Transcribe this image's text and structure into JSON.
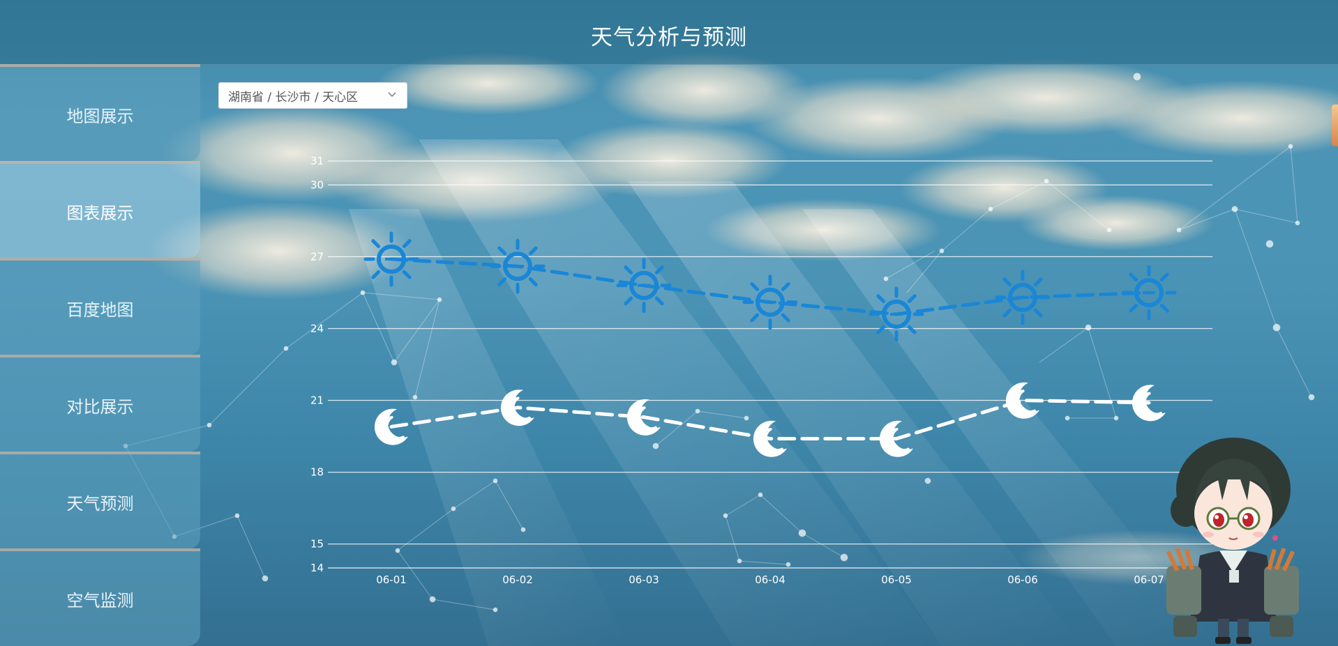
{
  "header": {
    "title": "天气分析与预测"
  },
  "sidebar": {
    "items": [
      {
        "label": "地图展示",
        "active": false
      },
      {
        "label": "图表展示",
        "active": true
      },
      {
        "label": "百度地图",
        "active": false
      },
      {
        "label": "对比展示",
        "active": false
      },
      {
        "label": "天气预测",
        "active": false
      },
      {
        "label": "空气监测",
        "active": false
      }
    ]
  },
  "region_select": {
    "value": "湖南省 / 长沙市 / 天心区",
    "icon": "chevron-down-icon"
  },
  "chart_data": {
    "type": "line",
    "categories": [
      "06-01",
      "06-02",
      "06-03",
      "06-04",
      "06-05",
      "06-06",
      "06-07"
    ],
    "y_ticks": [
      14,
      15,
      18,
      21,
      24,
      27,
      30,
      31
    ],
    "ylim": [
      14,
      31
    ],
    "grid": true,
    "series": [
      {
        "values": [
          26.9,
          26.6,
          25.8,
          25.1,
          24.6,
          25.3,
          25.5
        ],
        "color": "#1a86d6",
        "symbol": "sun-icon",
        "line_style": "dashed"
      },
      {
        "values": [
          19.9,
          20.7,
          20.3,
          19.4,
          19.4,
          21.0,
          20.9
        ],
        "color": "#ffffff",
        "symbol": "moon-icon",
        "line_style": "dashed"
      }
    ]
  },
  "colors": {
    "header_bg": "#2f7395",
    "sidebar_bg": "#5fa0be",
    "sidebar_active_bg": "#aad2e6",
    "sun": "#1a86d6",
    "moon": "#ffffff"
  },
  "mascot": {
    "icon": "anime-girl-mascot-icon"
  }
}
